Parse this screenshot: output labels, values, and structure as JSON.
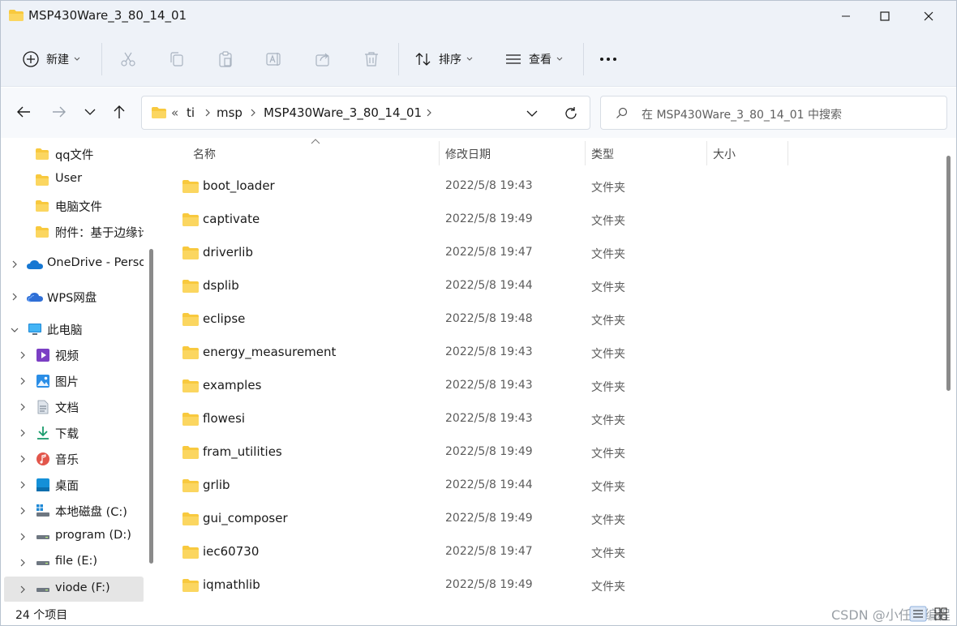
{
  "window": {
    "title": "MSP430Ware_3_80_14_01"
  },
  "toolbar": {
    "new_label": "新建",
    "sort_label": "排序",
    "view_label": "查看",
    "more_label": "..."
  },
  "address": {
    "overflow": "«",
    "crumbs": [
      "ti",
      "msp",
      "MSP430Ware_3_80_14_01"
    ]
  },
  "search": {
    "placeholder": "在 MSP430Ware_3_80_14_01 中搜索"
  },
  "nav": {
    "items": [
      {
        "label": "qq文件",
        "icon": "folder-icon"
      },
      {
        "label": "User",
        "icon": "folder-icon"
      },
      {
        "label": "电脑文件",
        "icon": "folder-icon"
      },
      {
        "label": "附件：基于边缘计",
        "icon": "folder-icon"
      },
      {
        "label": "OneDrive - Perso",
        "icon": "cloud-icon"
      },
      {
        "label": "WPS网盘",
        "icon": "cloud-icon"
      },
      {
        "label": "此电脑",
        "icon": "pc-icon"
      },
      {
        "label": "视频",
        "icon": "video-icon"
      },
      {
        "label": "图片",
        "icon": "pictures-icon"
      },
      {
        "label": "文档",
        "icon": "documents-icon"
      },
      {
        "label": "下载",
        "icon": "download-icon"
      },
      {
        "label": "音乐",
        "icon": "music-icon"
      },
      {
        "label": "桌面",
        "icon": "desktop-icon"
      },
      {
        "label": "本地磁盘 (C:)",
        "icon": "drive-icon"
      },
      {
        "label": "program (D:)",
        "icon": "drive-icon"
      },
      {
        "label": "file (E:)",
        "icon": "drive-icon"
      },
      {
        "label": "viode (F:)",
        "icon": "drive-icon"
      }
    ]
  },
  "columns": {
    "name": "名称",
    "date": "修改日期",
    "type": "类型",
    "size": "大小"
  },
  "files": [
    {
      "name": "boot_loader",
      "date": "2022/5/8 19:43",
      "type": "文件夹"
    },
    {
      "name": "captivate",
      "date": "2022/5/8 19:49",
      "type": "文件夹"
    },
    {
      "name": "driverlib",
      "date": "2022/5/8 19:47",
      "type": "文件夹"
    },
    {
      "name": "dsplib",
      "date": "2022/5/8 19:44",
      "type": "文件夹"
    },
    {
      "name": "eclipse",
      "date": "2022/5/8 19:48",
      "type": "文件夹"
    },
    {
      "name": "energy_measurement",
      "date": "2022/5/8 19:43",
      "type": "文件夹"
    },
    {
      "name": "examples",
      "date": "2022/5/8 19:43",
      "type": "文件夹"
    },
    {
      "name": "flowesi",
      "date": "2022/5/8 19:43",
      "type": "文件夹"
    },
    {
      "name": "fram_utilities",
      "date": "2022/5/8 19:49",
      "type": "文件夹"
    },
    {
      "name": "grlib",
      "date": "2022/5/8 19:44",
      "type": "文件夹"
    },
    {
      "name": "gui_composer",
      "date": "2022/5/8 19:49",
      "type": "文件夹"
    },
    {
      "name": "iec60730",
      "date": "2022/5/8 19:47",
      "type": "文件夹"
    },
    {
      "name": "iqmathlib",
      "date": "2022/5/8 19:49",
      "type": "文件夹"
    }
  ],
  "status": {
    "count": "24 个项目",
    "watermark": "CSDN @小任爱编程"
  },
  "colors": {
    "chrome_bg": "#eef2f8",
    "folder_yellow": "#f8c93e",
    "selected_bg": "#e5e5e5"
  }
}
